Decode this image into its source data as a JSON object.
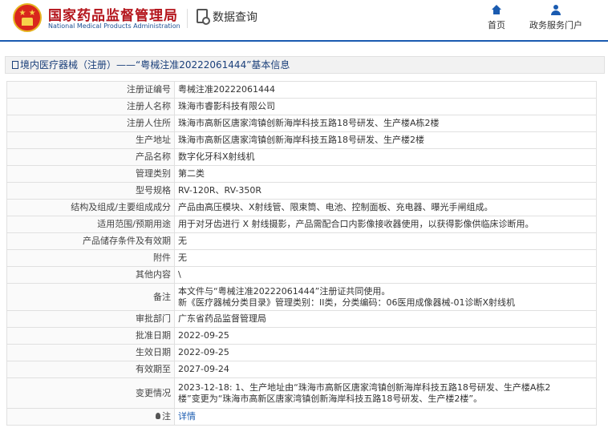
{
  "header": {
    "org_cn": "国家药品监督管理局",
    "org_en": "National Medical Products Administration",
    "data_query": "数据查询",
    "nav": [
      {
        "label": "首页",
        "icon": "home-icon"
      },
      {
        "label": "政务服务门户",
        "icon": "user-icon"
      }
    ],
    "accent_color": "#1a5bb0",
    "brand_color": "#b4141b"
  },
  "breadcrumb": "境内医疗器械（注册）——“粤械注准20222061444”基本信息",
  "rows": [
    {
      "label": "注册证编号",
      "value": "粤械注准20222061444"
    },
    {
      "label": "注册人名称",
      "value": "珠海市睿影科技有限公司"
    },
    {
      "label": "注册人住所",
      "value": "珠海市高新区唐家湾镇创新海岸科技五路18号研发、生产楼A栋2楼"
    },
    {
      "label": "生产地址",
      "value": "珠海市高新区唐家湾镇创新海岸科技五路18号研发、生产楼2楼"
    },
    {
      "label": "产品名称",
      "value": "数字化牙科X射线机"
    },
    {
      "label": "管理类别",
      "value": "第二类"
    },
    {
      "label": "型号规格",
      "value": "RV-120R、RV-350R"
    },
    {
      "label": "结构及组成/主要组成成分",
      "value": "产品由高压模块、X射线管、限束筒、电池、控制面板、充电器、曝光手闸组成。"
    },
    {
      "label": "适用范围/预期用途",
      "value": "用于对牙齿进行 X 射线摄影，产品需配合口内影像接收器使用，以获得影像供临床诊断用。"
    },
    {
      "label": "产品储存条件及有效期",
      "value": "无"
    },
    {
      "label": "附件",
      "value": "无"
    },
    {
      "label": "其他内容",
      "value": "\\"
    },
    {
      "label": "备注",
      "value_lines": [
        "本文件与“粤械注准20222061444”注册证共同使用。",
        "新《医疗器械分类目录》管理类别：II类，分类编码：06医用成像器械-01诊断X射线机"
      ]
    },
    {
      "label": "审批部门",
      "value": "广东省药品监督管理局"
    },
    {
      "label": "批准日期",
      "value": "2022-09-25"
    },
    {
      "label": "生效日期",
      "value": "2022-09-25"
    },
    {
      "label": "有效期至",
      "value": "2027-09-24"
    },
    {
      "label": "变更情况",
      "value_lines": [
        "2023-12-18: 1、生产地址由“珠海市高新区唐家湾镇创新海岸科技五路18号研发、生产楼A栋2",
        "楼”变更为“珠海市高新区唐家湾镇创新海岸科技五路18号研发、生产楼2楼”。"
      ]
    },
    {
      "label": "注",
      "value": "详情",
      "icon": "bulb-icon"
    }
  ]
}
